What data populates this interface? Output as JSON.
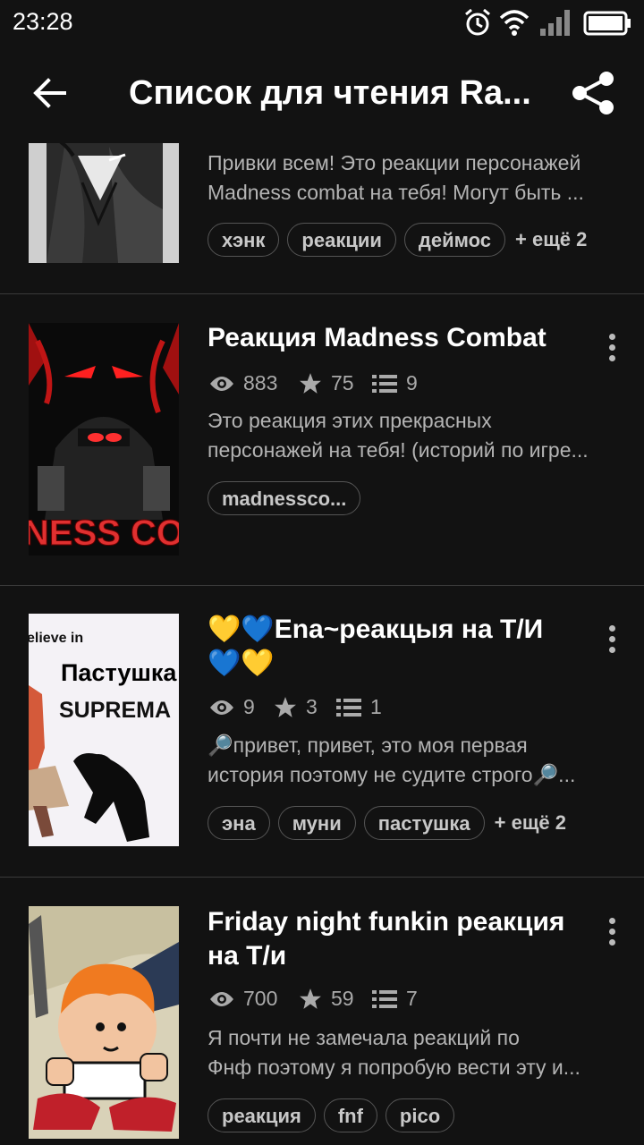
{
  "status_bar": {
    "time": "23:28"
  },
  "header": {
    "title": "Список для чтения Ra..."
  },
  "stories": [
    {
      "title": "",
      "desc_lines": [
        "Привки всем! Это реакции персонажей",
        "Madness combat на тебя! Могут быть ..."
      ],
      "tags": [
        "хэнк",
        "реакции",
        "деймос"
      ],
      "more_tags": "+ ещё 2"
    },
    {
      "title": "Реакция Madness Combat",
      "views": "883",
      "stars": "75",
      "parts": "9",
      "desc_lines": [
        "Это реакция этих прекрасных",
        "персонажей на тебя! (историй по игре..."
      ],
      "tags": [
        "madnessco..."
      ],
      "cover_text": "NESS COM"
    },
    {
      "title_line1": "💛💙Ena~реакцыя на Т/И",
      "title_line2": "💙💛",
      "views": "9",
      "stars": "3",
      "parts": "1",
      "desc_lines": [
        "🔎привет, привет, это моя первая",
        "история поэтому не судите строго🔎..."
      ],
      "tags": [
        "эна",
        "муни",
        "пастушка"
      ],
      "more_tags": "+ ещё 2",
      "cover_text1": "elieve in",
      "cover_text2": "Пастушка",
      "cover_text3": "SUPREMA"
    },
    {
      "title_line1": "Friday night funkin реакция",
      "title_line2": "на Т/и",
      "views": "700",
      "stars": "59",
      "parts": "7",
      "desc_lines": [
        "Я почти не замечала реакций по",
        "Фнф поэтому я попробую вести эту и..."
      ],
      "tags": [
        "реакция",
        "fnf",
        "pico"
      ]
    }
  ]
}
